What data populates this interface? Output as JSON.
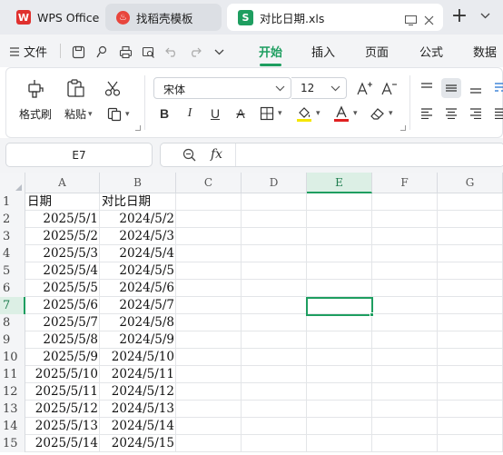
{
  "tabs": [
    {
      "label": "WPS Office"
    },
    {
      "label": "找稻壳模板"
    },
    {
      "label": "对比日期.xls"
    }
  ],
  "menu": {
    "file_label": "文件",
    "tabs": [
      {
        "label": "开始"
      },
      {
        "label": "插入"
      },
      {
        "label": "页面"
      },
      {
        "label": "公式"
      },
      {
        "label": "数据"
      }
    ]
  },
  "ribbon": {
    "format_painter_label": "格式刷",
    "paste_label": "粘贴",
    "font_name": "宋体",
    "font_size": "12"
  },
  "formula_bar": {
    "name_box": "E7",
    "fx_label": "fx",
    "content": ""
  },
  "sheet": {
    "columns": [
      "A",
      "B",
      "C",
      "D",
      "E",
      "F",
      "G"
    ],
    "active_column": "E",
    "active_row": "7",
    "rows": [
      {
        "n": "1",
        "a": "日期",
        "b": "对比日期"
      },
      {
        "n": "2",
        "a": "2025/5/1",
        "b": "2024/5/2"
      },
      {
        "n": "3",
        "a": "2025/5/2",
        "b": "2024/5/3"
      },
      {
        "n": "4",
        "a": "2025/5/3",
        "b": "2024/5/4"
      },
      {
        "n": "5",
        "a": "2025/5/4",
        "b": "2024/5/5"
      },
      {
        "n": "6",
        "a": "2025/5/5",
        "b": "2024/5/6"
      },
      {
        "n": "7",
        "a": "2025/5/6",
        "b": "2024/5/7"
      },
      {
        "n": "8",
        "a": "2025/5/7",
        "b": "2024/5/8"
      },
      {
        "n": "9",
        "a": "2025/5/8",
        "b": "2024/5/9"
      },
      {
        "n": "10",
        "a": "2025/5/9",
        "b": "2024/5/10"
      },
      {
        "n": "11",
        "a": "2025/5/10",
        "b": "2024/5/11"
      },
      {
        "n": "12",
        "a": "2025/5/11",
        "b": "2024/5/12"
      },
      {
        "n": "13",
        "a": "2025/5/12",
        "b": "2024/5/13"
      },
      {
        "n": "14",
        "a": "2025/5/13",
        "b": "2024/5/14"
      },
      {
        "n": "15",
        "a": "2025/5/14",
        "b": "2024/5/15"
      }
    ]
  },
  "colors": {
    "accent": "#1e9e60",
    "wps_red": "#e0302e",
    "header_bg": "#f4f5f7"
  }
}
